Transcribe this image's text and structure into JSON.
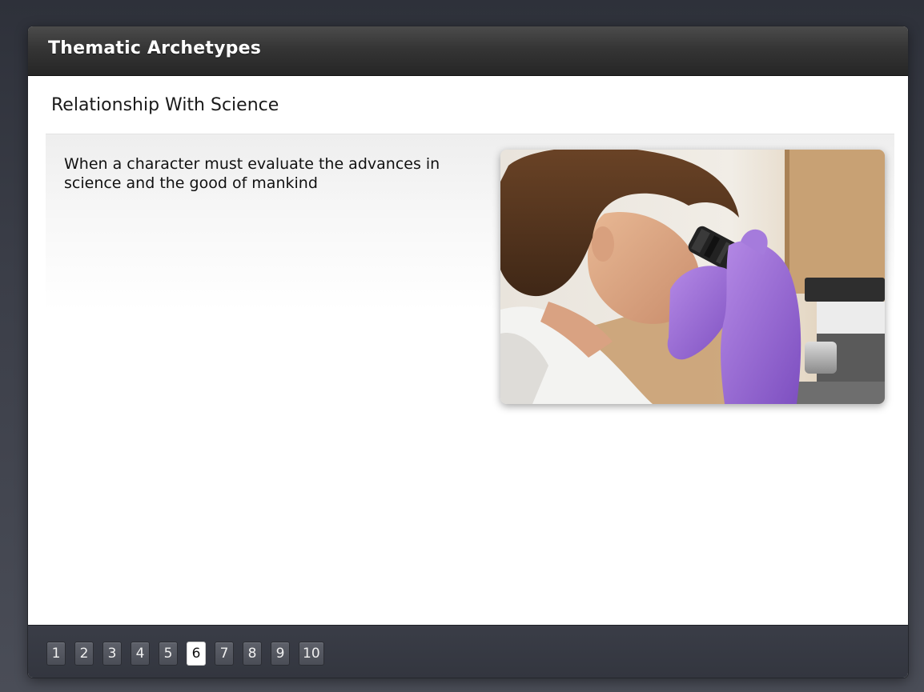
{
  "window": {
    "title": "Thematic Archetypes"
  },
  "slide": {
    "heading": "Relationship With Science",
    "body": "When a character must evaluate the advances in science and the good of mankind",
    "image": {
      "subject": "scientist-looking-into-microscope"
    }
  },
  "pager": {
    "current": "6",
    "pages": [
      {
        "label": "1",
        "active": false
      },
      {
        "label": "2",
        "active": false
      },
      {
        "label": "3",
        "active": false
      },
      {
        "label": "4",
        "active": false
      },
      {
        "label": "5",
        "active": false
      },
      {
        "label": "6",
        "active": true
      },
      {
        "label": "7",
        "active": false
      },
      {
        "label": "8",
        "active": false
      },
      {
        "label": "9",
        "active": false
      },
      {
        "label": "10",
        "active": false
      }
    ]
  },
  "colors": {
    "title_bar": "#2e2e2e",
    "nav_bar": "#363942",
    "active_page": "#ffffff",
    "glove": "#9b6fd6"
  }
}
